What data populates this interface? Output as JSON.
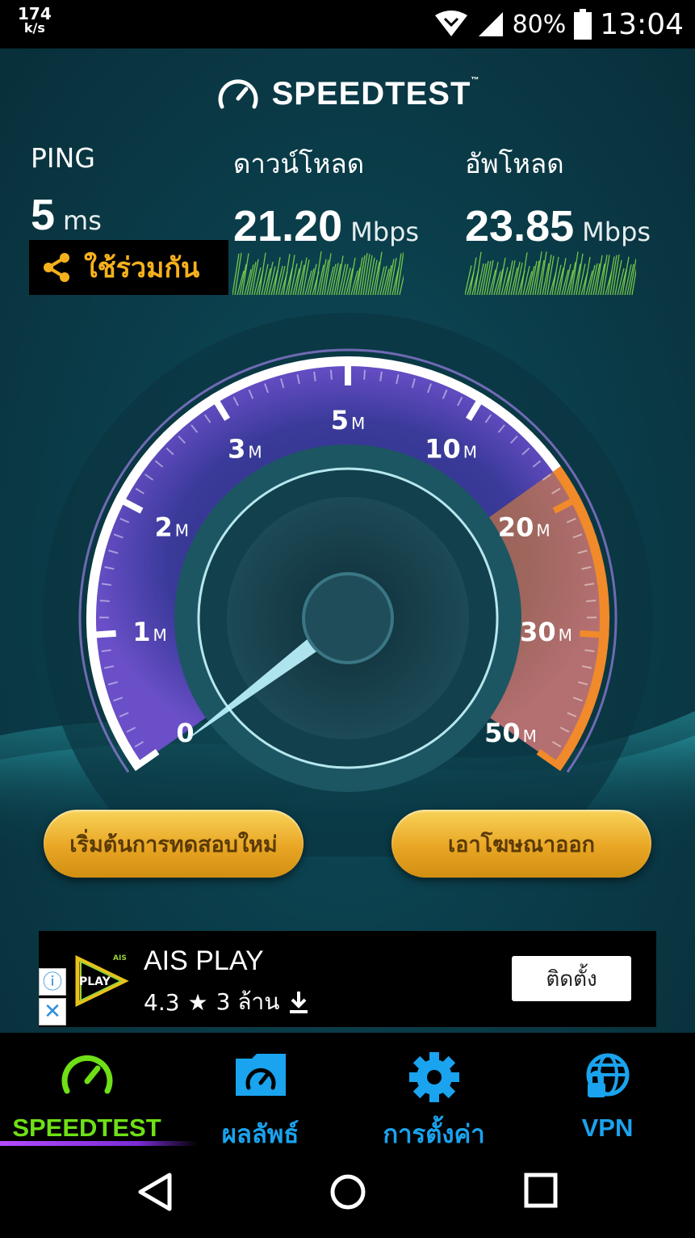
{
  "status_bar": {
    "net_speed_value": "174",
    "net_speed_unit": "k/s",
    "battery": "80%",
    "time": "13:04"
  },
  "app": {
    "brand": "SPEEDTEST",
    "trademark": "™"
  },
  "results": {
    "ping": {
      "label": "PING",
      "value": "5",
      "unit": "ms"
    },
    "download": {
      "label": "ดาวน์โหลด",
      "value": "21.20",
      "unit": "Mbps"
    },
    "upload": {
      "label": "อัพโหลด",
      "value": "23.85",
      "unit": "Mbps"
    }
  },
  "share_label": "ใช้ร่วมกัน",
  "gauge": {
    "ticks": [
      {
        "num": "0",
        "unit": ""
      },
      {
        "num": "1",
        "unit": "M"
      },
      {
        "num": "2",
        "unit": "M"
      },
      {
        "num": "3",
        "unit": "M"
      },
      {
        "num": "5",
        "unit": "M"
      },
      {
        "num": "10",
        "unit": "M"
      },
      {
        "num": "20",
        "unit": "M"
      },
      {
        "num": "30",
        "unit": "M"
      },
      {
        "num": "50",
        "unit": "M"
      }
    ],
    "needle_value": 0
  },
  "buttons": {
    "restart": "เริ่มต้นการทดสอบใหม่",
    "remove_ads": "เอาโฆษณาออก"
  },
  "ad": {
    "app_name": "AIS PLAY",
    "logo_text": "PLAY",
    "logo_brand": "AIS",
    "rating": "4.3",
    "installs": "3 ล้าน",
    "install_button": "ติดตั้ง"
  },
  "tabs": [
    {
      "label": "SPEEDTEST",
      "color": "#6fe016"
    },
    {
      "label": "ผลลัพธ์",
      "color": "#1aa3ee"
    },
    {
      "label": "การตั้งค่า",
      "color": "#1aa3ee"
    },
    {
      "label": "VPN",
      "color": "#1aa3ee"
    }
  ],
  "colors": {
    "accent": "#f5b11c",
    "active_tab": "#6fe016",
    "inactive_tab": "#1aa3ee",
    "gauge_arc": "#ffffff",
    "gauge_hot": "#f08a2a"
  }
}
